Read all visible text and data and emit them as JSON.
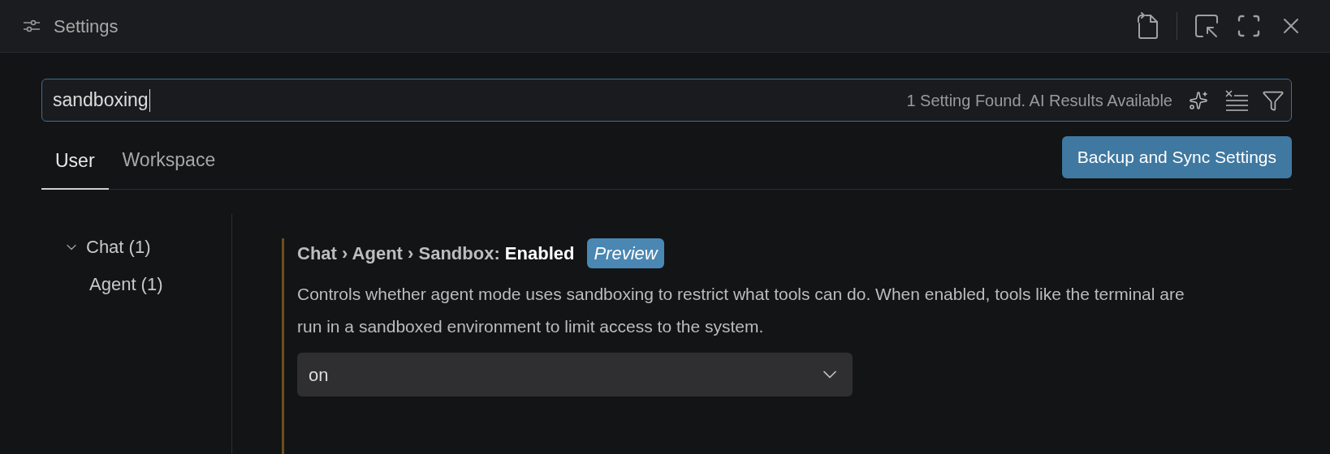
{
  "window": {
    "title": "Settings"
  },
  "search": {
    "value": "sandboxing",
    "result_count": "1 Setting Found. AI Results Available"
  },
  "tabs": [
    {
      "label": "User",
      "selected": true
    },
    {
      "label": "Workspace",
      "selected": false
    }
  ],
  "sync_button": "Backup and Sync Settings",
  "tree": [
    {
      "label": "Chat (1)",
      "expanded": true,
      "children": [
        {
          "label": "Agent (1)"
        }
      ]
    }
  ],
  "setting": {
    "category": "Chat › Agent › Sandbox:",
    "name": "Enabled",
    "badge": "Preview",
    "modified": true,
    "description": "Controls whether agent mode uses sandboxing to restrict what tools can do. When enabled, tools like the terminal are run in a sandboxed environment to limit access to the system.",
    "value": "on"
  }
}
